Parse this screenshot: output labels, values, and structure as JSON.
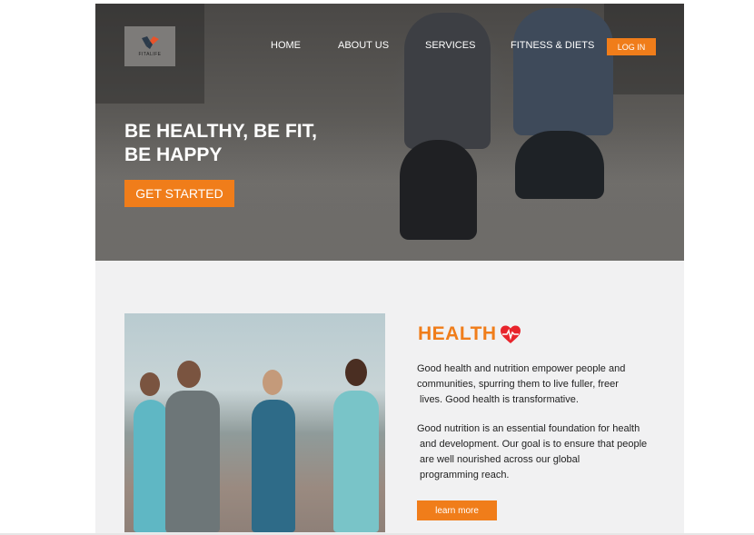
{
  "brand": {
    "name": "FITALIFE",
    "accent": "#f07d1a"
  },
  "nav": {
    "items": [
      {
        "label": "HOME"
      },
      {
        "label": "ABOUT US"
      },
      {
        "label": "SERVICES"
      },
      {
        "label": "FITNESS & DIETS"
      }
    ],
    "login_label": "LOG IN"
  },
  "hero": {
    "title_line1": "BE HEALTHY, BE FIT,",
    "title_line2": "BE HAPPY",
    "cta_label": "GET STARTED"
  },
  "health": {
    "title": "HEALTH",
    "icon": "heart-pulse-icon",
    "para1_lines": [
      "Good health and nutrition empower people and",
      "communities, spurring them to live fuller, freer",
      " lives. Good health is transformative."
    ],
    "para2_lines": [
      "Good nutrition is an essential foundation for health",
      " and development. Our goal is to ensure that people",
      " are well nourished across our global",
      " programming reach."
    ],
    "button_label": "learn more"
  }
}
